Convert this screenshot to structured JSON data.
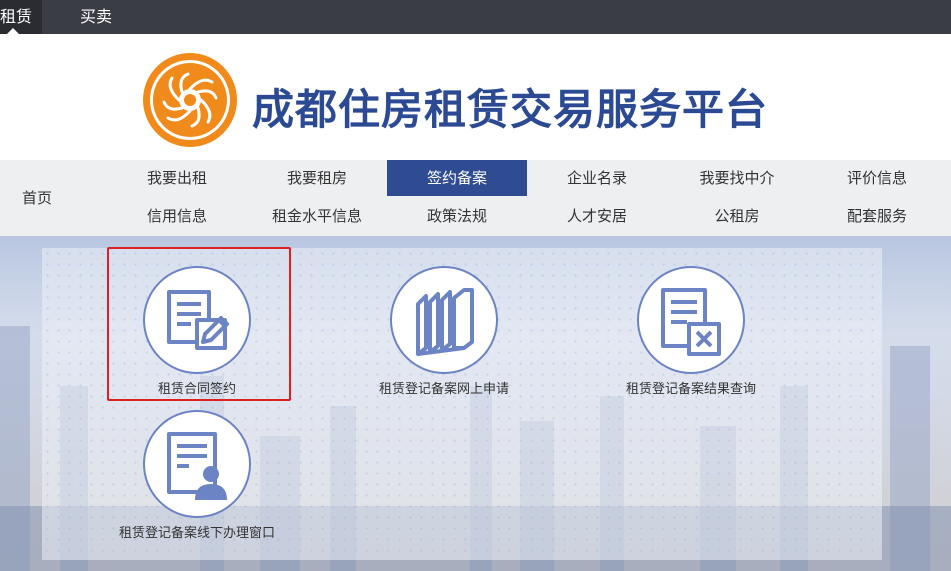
{
  "topbar": {
    "tabs": [
      "租赁",
      "买卖"
    ]
  },
  "header": {
    "title": "成都住房租赁交易服务平台"
  },
  "nav": {
    "home": "首页",
    "row1": [
      "我要出租",
      "我要租房",
      "签约备案",
      "企业名录",
      "我要找中介",
      "评价信息"
    ],
    "row2": [
      "信用信息",
      "租金水平信息",
      "政策法规",
      "人才安居",
      "公租房",
      "配套服务"
    ],
    "active": "签约备案"
  },
  "services": [
    {
      "label": "租赁合同签约",
      "icon": "contract-sign-icon"
    },
    {
      "label": "租赁登记备案网上申请",
      "icon": "files-binder-icon"
    },
    {
      "label": "租赁登记备案结果查询",
      "icon": "document-query-icon"
    },
    {
      "label": "租赁登记备案线下办理窗口",
      "icon": "document-person-icon"
    }
  ],
  "colors": {
    "topbar": "#3a3d44",
    "brand": "#2c4a93",
    "nav_active": "#2f4c93",
    "icon": "#6c83c4",
    "logo": "#f08a1a",
    "highlight": "#e02020"
  }
}
